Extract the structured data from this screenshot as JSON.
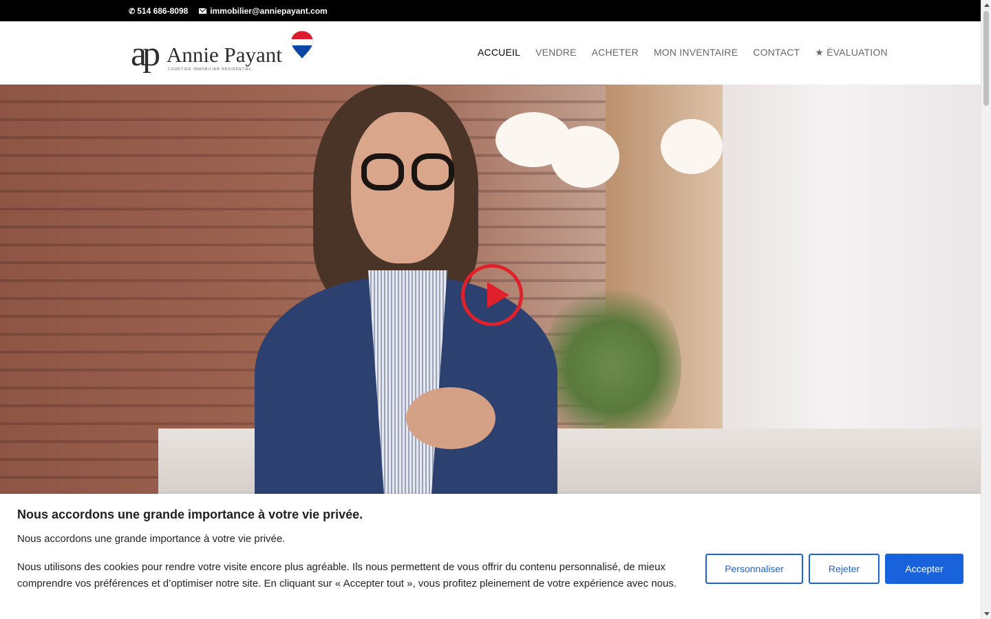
{
  "topbar": {
    "phone": "514 686-8098",
    "email": "immobilier@anniepayant.com",
    "phone_icon": "phone-icon",
    "email_icon": "envelope-icon"
  },
  "header": {
    "logo_monogram": "ap",
    "logo_name": "Annie Payant",
    "logo_tagline": "COURTIER IMMOBILIER RÉSIDENTIEL",
    "nav": [
      {
        "label": "ACCUEIL",
        "active": true
      },
      {
        "label": "VENDRE"
      },
      {
        "label": "ACHETER"
      },
      {
        "label": "MON INVENTAIRE"
      },
      {
        "label": "CONTACT"
      },
      {
        "label": "★ ÉVALUATION"
      }
    ]
  },
  "hero": {
    "play_icon": "play-icon",
    "accent_color": "#e0202a"
  },
  "cookie": {
    "title": "Nous accordons une grande importance à votre vie privée.",
    "intro": "Nous accordons une grande importance à votre vie privée.",
    "body": "Nous utilisons des cookies pour rendre votre visite encore plus agréable. Ils nous permettent de vous offrir du contenu personnalisé, de mieux comprendre vos préférences et d’optimiser notre site. En cliquant sur « Accepter tout », vous profitez pleinement de votre expérience avec nous.",
    "customize_label": "Personnaliser",
    "reject_label": "Rejeter",
    "accept_label": "Accepter",
    "button_color": "#1863dc"
  }
}
